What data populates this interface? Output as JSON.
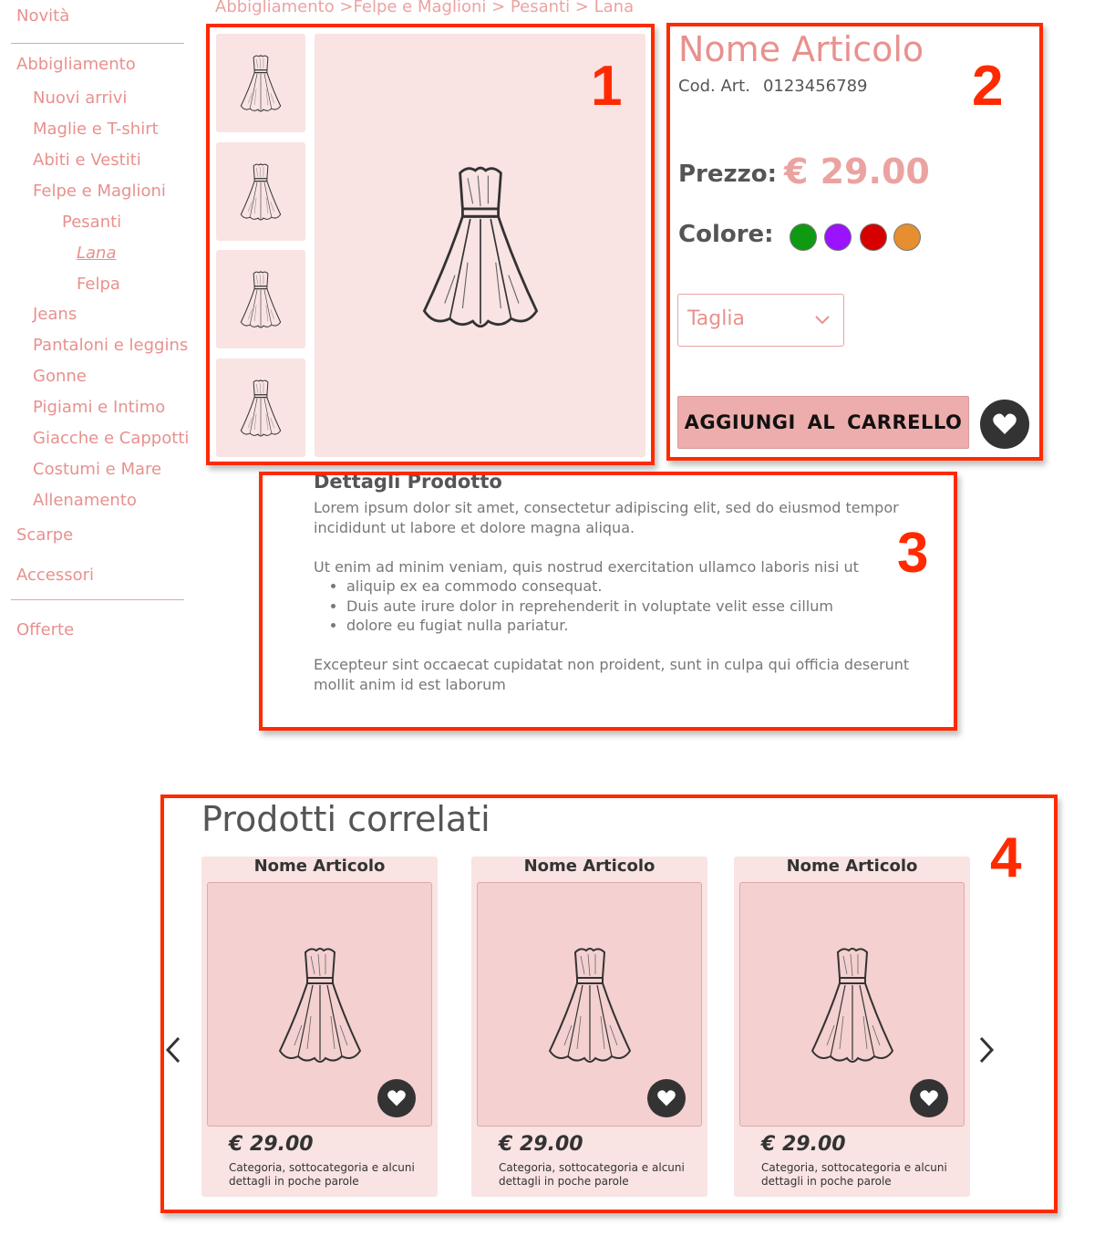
{
  "sidebar": {
    "items": [
      {
        "label": "Novità"
      },
      {
        "label": "Abbigliamento"
      },
      {
        "label": "Nuovi arrivi"
      },
      {
        "label": "Maglie e T-shirt"
      },
      {
        "label": "Abiti e Vestiti"
      },
      {
        "label": "Felpe e Maglioni"
      },
      {
        "label": "Pesanti"
      },
      {
        "label": "Lana"
      },
      {
        "label": "Felpa"
      },
      {
        "label": "Jeans"
      },
      {
        "label": "Pantaloni e leggins"
      },
      {
        "label": "Gonne"
      },
      {
        "label": "Pigiami e Intimo"
      },
      {
        "label": "Giacche e Cappotti"
      },
      {
        "label": "Costumi e Mare"
      },
      {
        "label": "Allenamento"
      },
      {
        "label": "Scarpe"
      },
      {
        "label": "Accessori"
      },
      {
        "label": "Offerte"
      }
    ]
  },
  "breadcrumb": "Abbigliamento >Felpe e Maglioni > Pesanti > Lana",
  "annotations": [
    "1",
    "2",
    "3",
    "4"
  ],
  "product": {
    "name": "Nome Articolo",
    "code_label": "Cod. Art.",
    "code": "0123456789",
    "price_label": "Prezzo:",
    "price": "€ 29.00",
    "color_label": "Colore:",
    "colors": [
      "#0f9a12",
      "#9b12ff",
      "#d70000",
      "#e68e30"
    ],
    "size_placeholder": "Taglia",
    "add_to_cart": "AGGIUNGI AL CARRELLO"
  },
  "details": {
    "title": "Dettagli Prodotto",
    "p1": "Lorem ipsum dolor sit amet, consectetur adipiscing elit, sed do eiusmod tempor incididunt ut labore et dolore magna aliqua.",
    "p2": "Ut enim ad minim veniam, quis nostrud exercitation ullamco laboris nisi ut",
    "bullets": [
      "aliquip ex ea commodo consequat.",
      "Duis aute irure dolor in reprehenderit in voluptate velit esse cillum",
      "dolore eu fugiat nulla pariatur."
    ],
    "p3": "Excepteur sint occaecat cupidatat non proident, sunt in culpa qui officia deserunt mollit anim id est laborum"
  },
  "related": {
    "title": "Prodotti correlati",
    "cards": [
      {
        "name": "Nome Articolo",
        "price": "€ 29.00",
        "desc": "Categoria, sottocategoria e alcuni dettagli in poche parole"
      },
      {
        "name": "Nome Articolo",
        "price": "€ 29.00",
        "desc": "Categoria, sottocategoria e alcuni dettagli in poche parole"
      },
      {
        "name": "Nome Articolo",
        "price": "€ 29.00",
        "desc": "Categoria, sottocategoria e alcuni dettagli in poche parole"
      }
    ]
  },
  "icons": {
    "favorite": "heart-icon",
    "select": "chevron-down-icon",
    "prev": "chevron-left-icon",
    "next": "chevron-right-icon",
    "product_image": "dress-icon"
  },
  "colors": {
    "accent": "#e8918e",
    "annotation": "#ff2a00",
    "panel": "#f9e3e3"
  }
}
